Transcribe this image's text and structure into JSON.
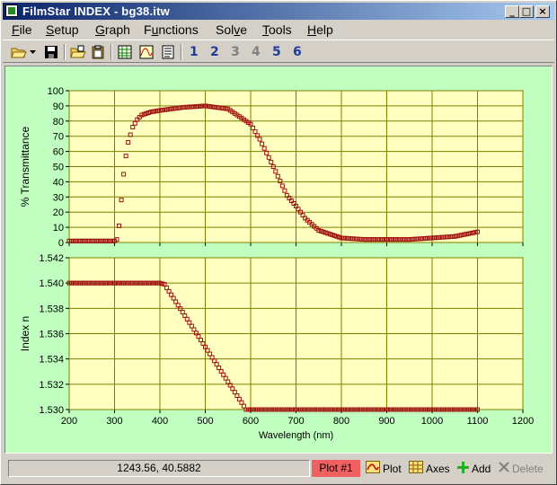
{
  "window": {
    "title": "FilmStar INDEX - bg38.itw",
    "controls": [
      "_",
      "□",
      "×"
    ]
  },
  "menu": [
    {
      "label": "File",
      "u": "F",
      "rest": "ile"
    },
    {
      "label": "Setup",
      "u": "S",
      "rest": "etup"
    },
    {
      "label": "Graph",
      "u": "G",
      "rest": "raph"
    },
    {
      "label": "Functions",
      "pre": "F",
      "u": "u",
      "rest": "nctions"
    },
    {
      "label": "Solve",
      "pre": "Sol",
      "u": "v",
      "rest": "e"
    },
    {
      "label": "Tools",
      "u": "T",
      "rest": "ools"
    },
    {
      "label": "Help",
      "u": "H",
      "rest": "elp"
    }
  ],
  "toolbar": {
    "buttons": [
      "open-folder-icon",
      "dropdown-arrow-icon",
      "save-icon",
      "open-file-icon",
      "clipboard-icon",
      "table-icon",
      "chart-icon",
      "document-icon"
    ],
    "numbers": [
      {
        "label": "1",
        "enabled": true
      },
      {
        "label": "2",
        "enabled": true
      },
      {
        "label": "3",
        "enabled": false
      },
      {
        "label": "4",
        "enabled": false
      },
      {
        "label": "5",
        "enabled": true
      },
      {
        "label": "6",
        "enabled": true
      }
    ]
  },
  "chart_data": [
    {
      "type": "scatter",
      "title": "",
      "xlabel": "",
      "ylabel": "% Transmittance",
      "xlim": [
        200,
        1200
      ],
      "ylim": [
        0,
        100
      ],
      "yticks": [
        "0",
        "10",
        "20",
        "30",
        "40",
        "50",
        "60",
        "70",
        "80",
        "90",
        "100"
      ],
      "grid": true,
      "series": [
        {
          "color": "#a01010",
          "x": [
            200,
            300,
            305,
            310,
            315,
            320,
            325,
            330,
            340,
            350,
            360,
            380,
            400,
            450,
            500,
            550,
            600,
            620,
            650,
            680,
            700,
            720,
            750,
            800,
            850,
            900,
            950,
            1000,
            1050,
            1100
          ],
          "y": [
            1,
            1,
            2,
            11,
            28,
            45,
            57,
            66,
            76,
            81,
            84,
            86,
            87,
            89,
            90,
            88,
            78,
            68,
            50,
            31,
            24,
            16,
            8,
            3,
            2,
            2,
            2,
            3,
            4,
            7
          ]
        }
      ]
    },
    {
      "type": "scatter",
      "title": "",
      "xlabel": "Wavelength (nm)",
      "ylabel": "Index n",
      "xlim": [
        200,
        1200
      ],
      "ylim": [
        1.53,
        1.542
      ],
      "xticks": [
        "200",
        "300",
        "400",
        "500",
        "600",
        "700",
        "800",
        "900",
        "1000",
        "1100",
        "1200"
      ],
      "yticks": [
        "1.530",
        "1.532",
        "1.534",
        "1.536",
        "1.538",
        "1.540",
        "1.542"
      ],
      "grid": true,
      "series": [
        {
          "color": "#a01010",
          "x": [
            200,
            400,
            410,
            590,
            600,
            1100
          ],
          "y": [
            1.54,
            1.54,
            1.5399,
            1.53,
            1.53,
            1.53
          ]
        }
      ]
    }
  ],
  "status": {
    "coords": "1243.56, 40.5882",
    "plot_badge": "Plot #1",
    "plot_label": "Plot",
    "axes_label": "Axes",
    "add_label": "Add",
    "delete_label": "Delete",
    "badge_color": "#f06060"
  }
}
